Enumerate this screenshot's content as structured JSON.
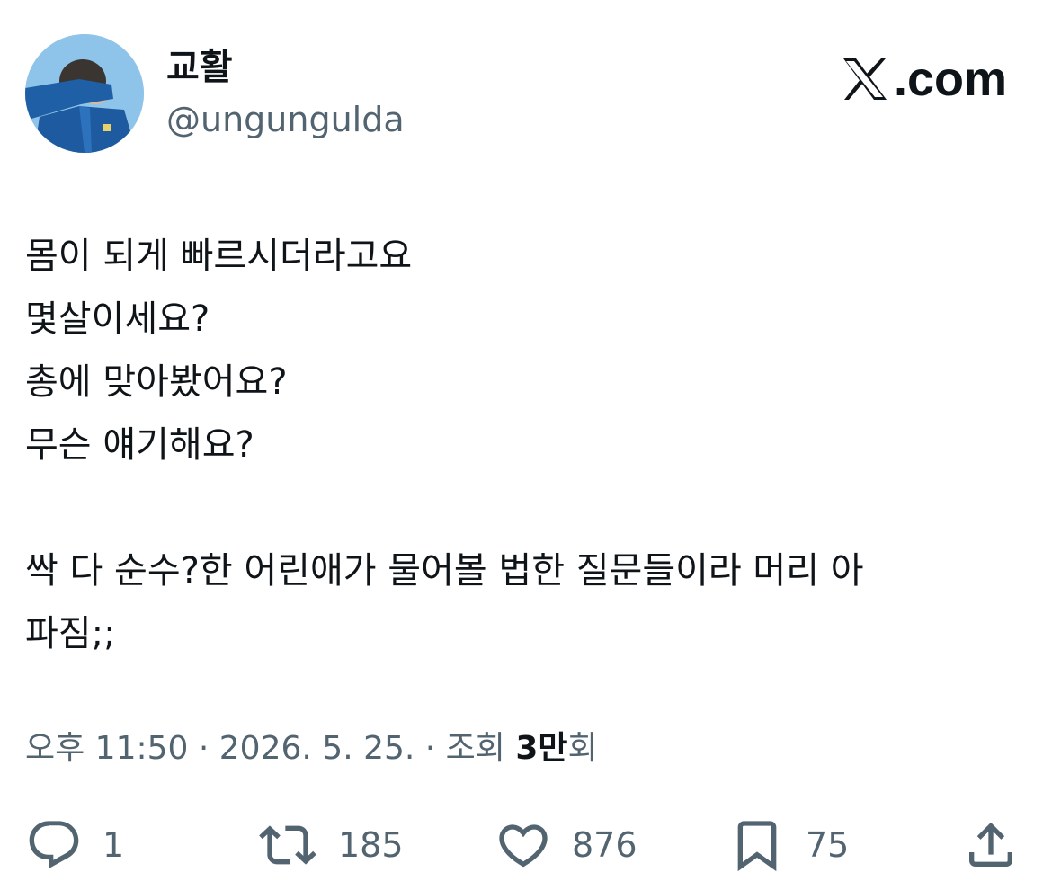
{
  "user": {
    "display_name": "교활",
    "handle": "@ungungulda",
    "avatar_icon": "avatar-photo"
  },
  "brand": {
    "icon": "x-logo-icon",
    "text": ".com"
  },
  "tweet": {
    "lines": [
      "몸이 되게 빠르시더라고요",
      "몇살이세요?",
      "총에 맞아봤어요?",
      "무슨 얘기해요?",
      "",
      "싹 다 순수?한 어린애가 물어볼 법한 질문들이라 머리 아",
      "파짐;;"
    ]
  },
  "meta": {
    "time": "오후 11:50",
    "separator": " · ",
    "date": "2026. 5. 25.",
    "views_prefix": "조회 ",
    "views_count": "3만",
    "views_suffix": "회"
  },
  "actions": {
    "reply": {
      "icon": "reply-icon",
      "count": "1"
    },
    "retweet": {
      "icon": "retweet-icon",
      "count": "185"
    },
    "like": {
      "icon": "heart-icon",
      "count": "876"
    },
    "bookmark": {
      "icon": "bookmark-icon",
      "count": "75"
    },
    "share": {
      "icon": "share-icon"
    }
  },
  "colors": {
    "text_primary": "#0f1419",
    "text_secondary": "#536471",
    "avatar_sky": "#8fc4ea",
    "avatar_jacket": "#1f5fa6"
  }
}
